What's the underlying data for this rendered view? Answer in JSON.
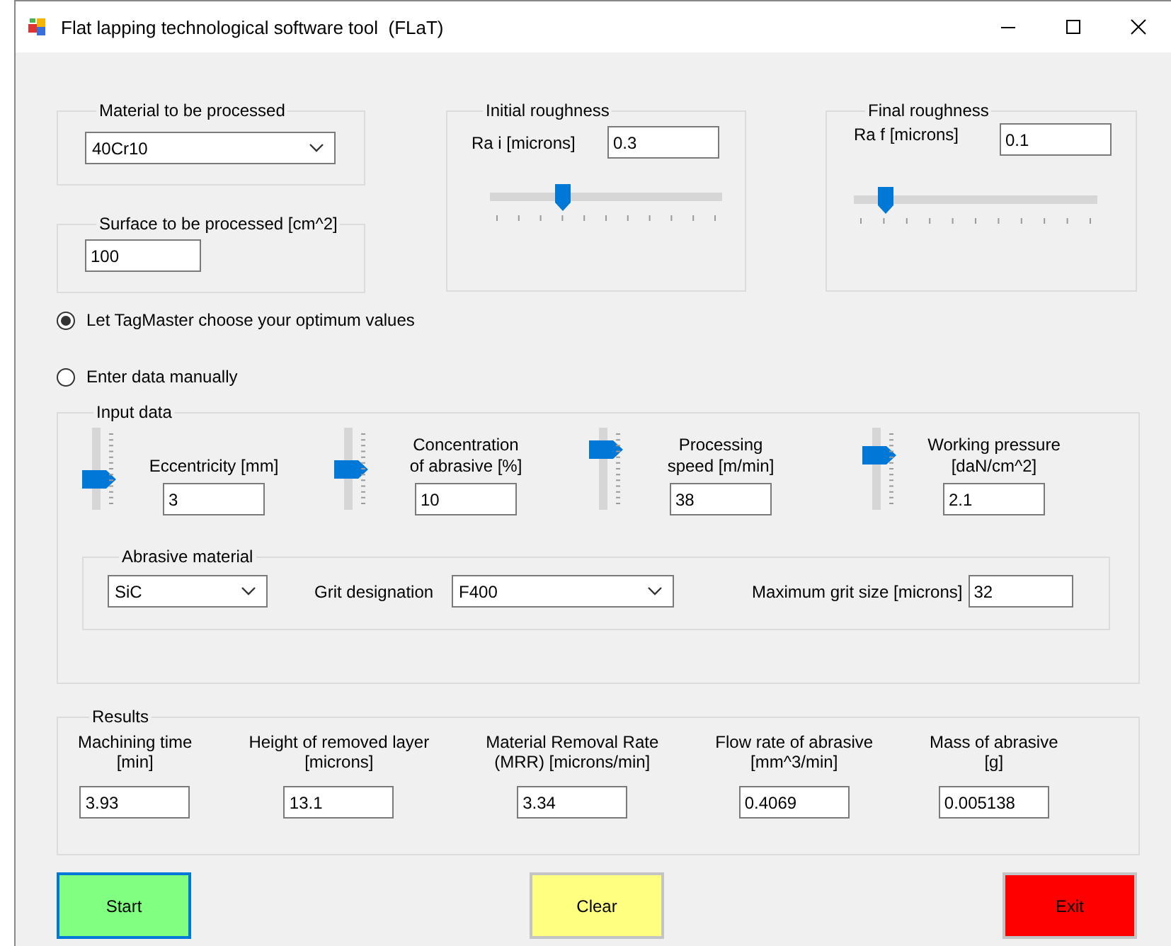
{
  "window": {
    "title": "Flat lapping technological software tool  (FLaT)"
  },
  "material": {
    "title": "Material to be processed",
    "value": "40Cr10"
  },
  "surface": {
    "title": "Surface to be processed [cm^2]",
    "value": "100"
  },
  "roughness": [
    {
      "title": "Initial roughness",
      "label": "Ra i [microns]",
      "value": "0.3",
      "level": 0.31
    },
    {
      "title": "Final roughness",
      "label": "Ra f [microns]",
      "value": "0.1",
      "level": 0.13
    }
  ],
  "modes": [
    {
      "label": "Let TagMaster choose your optimum values",
      "selected": true
    },
    {
      "label": "Enter data manually",
      "selected": false
    }
  ],
  "input_data": {
    "title": "Input data",
    "parameters": [
      {
        "label": "Eccentricity [mm]",
        "value": "3",
        "level": 0.38
      },
      {
        "label": "Concentration\nof abrasive [%]",
        "value": "10",
        "level": 0.5
      },
      {
        "label": "Processing\nspeed [m/min]",
        "value": "38",
        "level": 0.75
      },
      {
        "label": "Working pressure\n[daN/cm^2]",
        "value": "2.1",
        "level": 0.68
      }
    ],
    "abrasive": {
      "title": "Abrasive material",
      "material": "SiC",
      "grit_label": "Grit designation",
      "grit": "F400",
      "max_grit_label": "Maximum grit size [microns]",
      "max_grit": "32"
    }
  },
  "results": {
    "title": "Results",
    "items": [
      {
        "label": "Machining time\n[min]",
        "value": "3.93"
      },
      {
        "label": "Height of removed layer\n[microns]",
        "value": "13.1"
      },
      {
        "label": "Material Removal Rate\n(MRR) [microns/min]",
        "value": "3.34"
      },
      {
        "label": "Flow rate of abrasive\n[mm^3/min]",
        "value": "0.4069"
      },
      {
        "label": "Mass of abrasive\n[g]",
        "value": "0.005138"
      }
    ]
  },
  "buttons": [
    {
      "label": "Start",
      "color": "#80ff80",
      "focused": true
    },
    {
      "label": "Clear",
      "color": "#ffff80",
      "focused": false
    },
    {
      "label": "Exit",
      "color": "#ff0000",
      "focused": false
    }
  ]
}
